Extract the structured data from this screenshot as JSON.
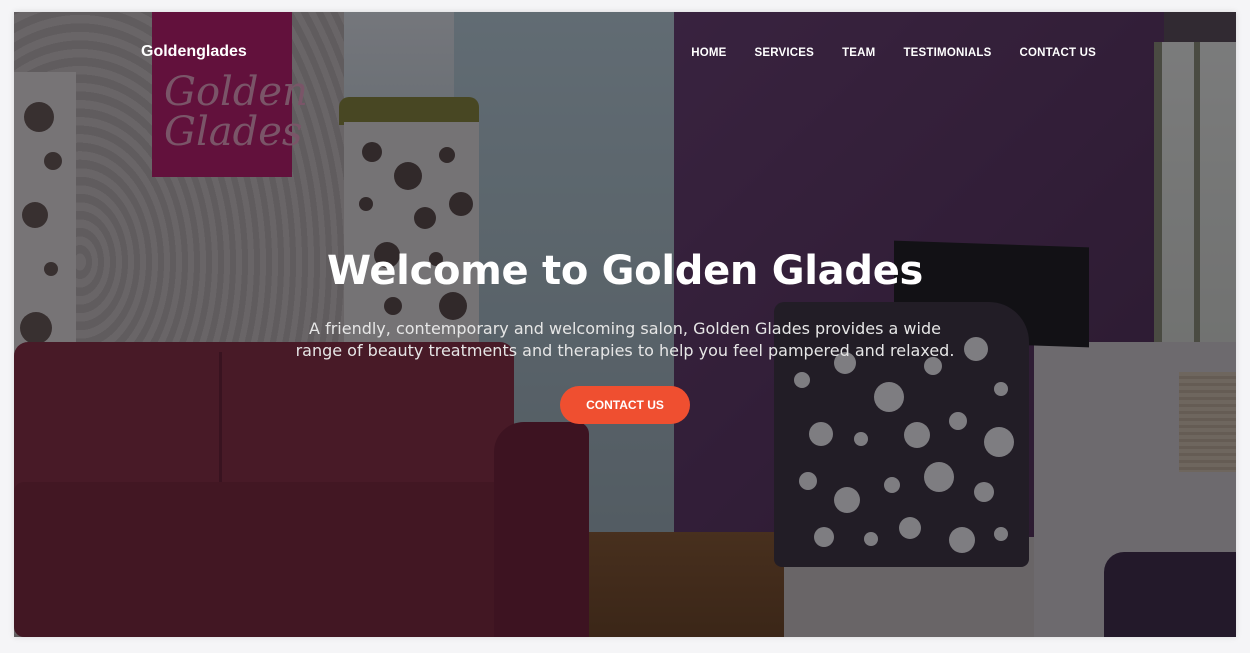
{
  "navbar": {
    "brand": "Goldenglades",
    "links": [
      "HOME",
      "SERVICES",
      "TEAM",
      "TESTIMONIALS",
      "CONTACT US"
    ]
  },
  "hero": {
    "title": "Welcome to Golden Glades",
    "subtitle": "A friendly, contemporary and welcoming salon, Golden Glades provides a wide range of beauty treatments and therapies to help you feel pampered and relaxed.",
    "cta_label": "CONTACT US",
    "cta_color": "#ef4f30",
    "background": "salon reception photo with dark overlay"
  }
}
